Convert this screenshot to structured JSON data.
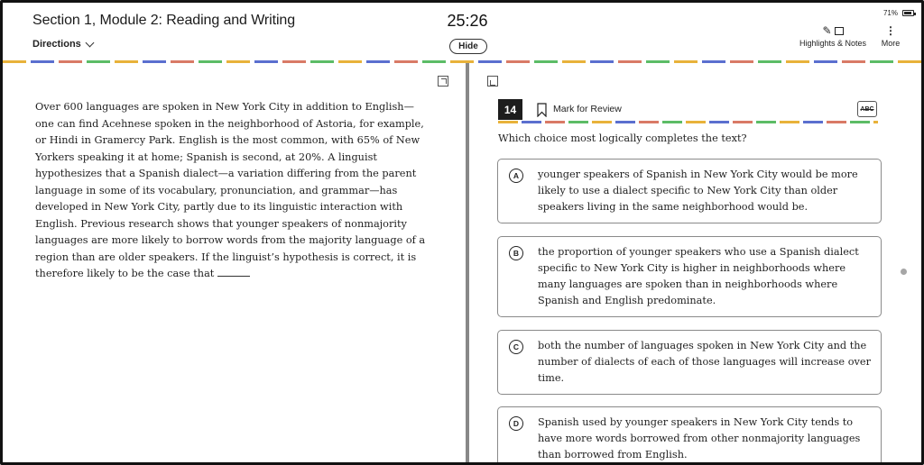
{
  "header": {
    "section_title": "Section 1, Module 2: Reading and Writing",
    "directions_label": "Directions",
    "timer": "25:26",
    "hide_label": "Hide",
    "battery_percent": "71%",
    "highlights_label": "Highlights & Notes",
    "more_label": "More"
  },
  "icons": {
    "directions_chevron": "chevron-down-icon",
    "highlight": "pencil-icon",
    "notes": "note-icon",
    "more": "more-vertical-icon",
    "expand": "expand-icon",
    "collapse": "collapse-icon",
    "bookmark": "bookmark-icon",
    "strike": "abc-strikethrough-icon",
    "battery": "battery-icon"
  },
  "passage": {
    "text_before_blank": "Over 600 languages are spoken in New York City in addition to English—one can find Acehnese spoken in the neighborhood of Astoria, for example, or Hindi in Gramercy Park. English is the most common, with 65% of New Yorkers speaking it at home; Spanish is second, at 20%. A linguist hypothesizes that a Spanish dialect—a variation differing from the parent language in some of its vocabulary, pronunciation, and grammar—has developed in New York City, partly due to its linguistic interaction with English. Previous research shows that younger speakers of nonmajority languages are more likely to borrow words from the majority language of a region than are older speakers. If the linguist’s hypothesis is correct, it is therefore likely to be the case that"
  },
  "question": {
    "number": "14",
    "mark_label": "Mark for Review",
    "strike_label": "ABC",
    "prompt": "Which choice most logically completes the text?",
    "choices": [
      {
        "letter": "A",
        "text": "younger speakers of Spanish in New York City would be more likely to use a dialect specific to New York City than older speakers living in the same neighborhood would be."
      },
      {
        "letter": "B",
        "text": "the proportion of younger speakers who use a Spanish dialect specific to New York City is higher in neighborhoods where many languages are spoken than in neighborhoods where Spanish and English predominate."
      },
      {
        "letter": "C",
        "text": "both the number of languages spoken in New York City and the number of dialects of each of those languages will increase over time."
      },
      {
        "letter": "D",
        "text": "Spanish used by younger speakers in New York City tends to have more words borrowed from other nonmajority languages than borrowed from English."
      }
    ]
  }
}
